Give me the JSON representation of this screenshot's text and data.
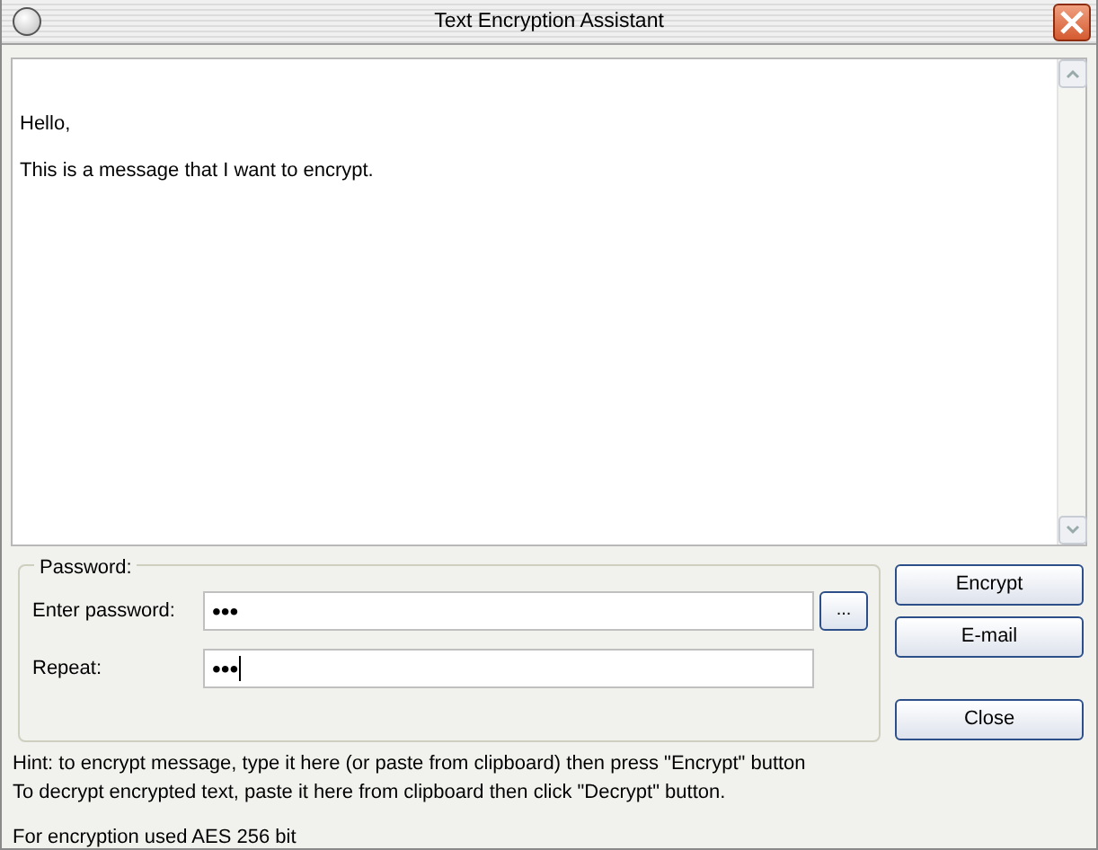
{
  "window": {
    "title": "Text Encryption Assistant"
  },
  "message": {
    "paragraphs": [
      "Hello,",
      "This is a message that I want to encrypt."
    ]
  },
  "password_group": {
    "legend": "Password:",
    "fields": [
      {
        "label": "Enter password:",
        "value": "•••",
        "browse": "...",
        "focused": false
      },
      {
        "label": "Repeat:",
        "value": "•••",
        "focused": true
      }
    ]
  },
  "buttons": [
    {
      "label": "Encrypt",
      "kind": "action"
    },
    {
      "label": "E-mail",
      "kind": "action"
    },
    {
      "label": "Close",
      "kind": "close"
    }
  ],
  "hints": [
    "Hint: to encrypt message, type it here (or paste from clipboard) then press \"Encrypt\" button",
    "To decrypt encrypted text, paste it here from clipboard then click \"Decrypt\" button."
  ],
  "footer": "For encryption used AES 256 bit"
}
